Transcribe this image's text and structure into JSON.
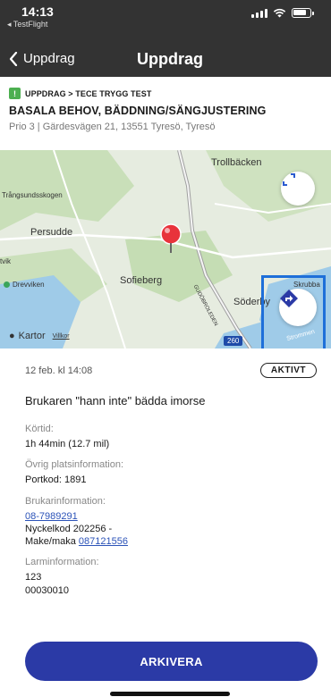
{
  "status": {
    "time": "14:13",
    "back_app": "◂ TestFlight"
  },
  "nav": {
    "back_label": "Uppdrag",
    "title": "Uppdrag"
  },
  "header": {
    "breadcrumb": "UPPDRAG > TECE TRYGG TEST",
    "title": "BASALA BEHOV, BÄDDNING/SÄNGJUSTERING",
    "subtitle": "Prio 3 | Gärdesvägen 21, 13551 Tyresö, Tyresö"
  },
  "map": {
    "labels": {
      "trollbacken": "Trollbäcken",
      "trangsund": "Trångsundsskogen",
      "persudde": "Persudde",
      "tvik": "tvik",
      "drevviken": "Drevviken",
      "sofieberg": "Sofieberg",
      "soderby": "Söderby",
      "skrubba": "Skrubba",
      "gudo": "GUDÖBROLEDEN",
      "strom": "Strommen",
      "road": "260"
    },
    "attribution": "Kartor",
    "terms": "Villkor",
    "icons": {
      "fullscreen": "expand-icon",
      "route": "directions-icon",
      "pin": "map-pin-icon"
    }
  },
  "details": {
    "date": "12 feb. kl 14:08",
    "status_badge": "AKTIVT",
    "headline": "Brukaren \"hann inte\" bädda imorse",
    "drive_time_label": "Körtid:",
    "drive_time_value": "1h 44min (12.7 mil)",
    "other_location_label": "Övrig platsinformation:",
    "other_location_value": "Portkod: 1891",
    "user_info_label": "Brukarinformation:",
    "user_phone": "08-7989291",
    "user_key": "Nyckelkod 202256 -",
    "user_spouse_prefix": "Make/maka",
    "user_spouse_phone": "087121556",
    "alarm_label": "Larminformation:",
    "alarm_line1": "123",
    "alarm_line2": "00030010"
  },
  "actions": {
    "archive": "ARKIVERA"
  },
  "colors": {
    "header_bg": "#333333",
    "primary": "#2b3aa6",
    "link": "#2c53b8",
    "alert_green": "#4caf50"
  }
}
